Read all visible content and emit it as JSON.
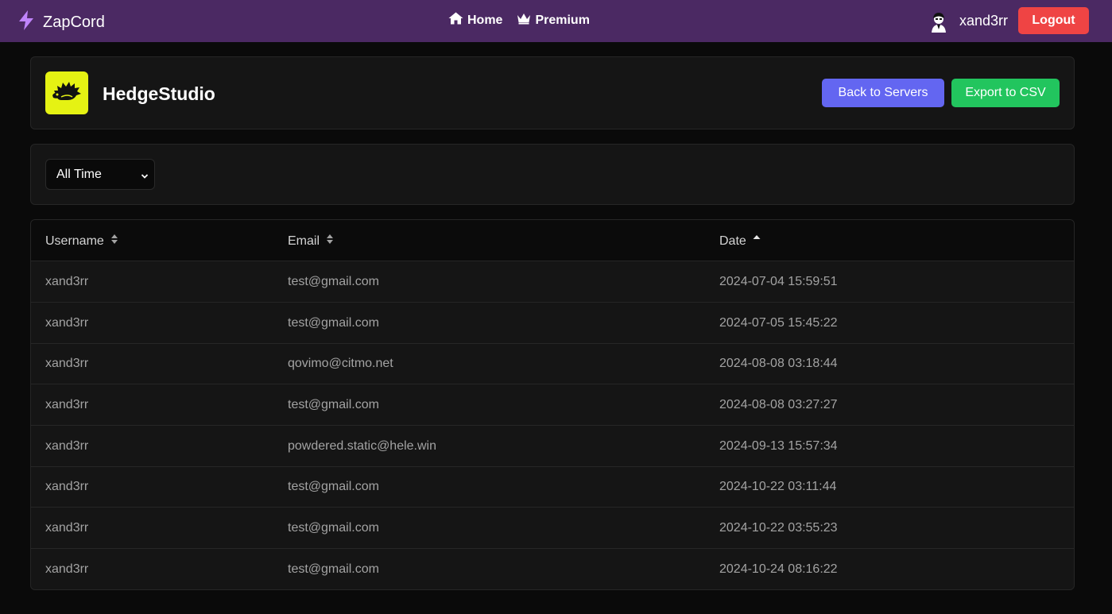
{
  "app": {
    "brand": "ZapCord",
    "accent": "#c084fc",
    "navbar_color": "#4b2963"
  },
  "nav": {
    "home_label": "Home",
    "premium_label": "Premium"
  },
  "user": {
    "name": "xand3rr",
    "logout_label": "Logout"
  },
  "server": {
    "name": "HedgeStudio",
    "back_label": "Back to Servers",
    "export_label": "Export to CSV",
    "logo_color": "#e5f213"
  },
  "filter": {
    "selected": "All Time"
  },
  "table": {
    "columns": [
      {
        "label": "Username",
        "sort": "none"
      },
      {
        "label": "Email",
        "sort": "none"
      },
      {
        "label": "Date",
        "sort": "ascending"
      }
    ],
    "rows": [
      {
        "username": "xand3rr",
        "email": "test@gmail.com",
        "date": "2024-07-04 15:59:51"
      },
      {
        "username": "xand3rr",
        "email": "test@gmail.com",
        "date": "2024-07-05 15:45:22"
      },
      {
        "username": "xand3rr",
        "email": "qovimo@citmo.net",
        "date": "2024-08-08 03:18:44"
      },
      {
        "username": "xand3rr",
        "email": "test@gmail.com",
        "date": "2024-08-08 03:27:27"
      },
      {
        "username": "xand3rr",
        "email": "powdered.static@hele.win",
        "date": "2024-09-13 15:57:34"
      },
      {
        "username": "xand3rr",
        "email": "test@gmail.com",
        "date": "2024-10-22 03:11:44"
      },
      {
        "username": "xand3rr",
        "email": "test@gmail.com",
        "date": "2024-10-22 03:55:23"
      },
      {
        "username": "xand3rr",
        "email": "test@gmail.com",
        "date": "2024-10-24 08:16:22"
      }
    ]
  }
}
